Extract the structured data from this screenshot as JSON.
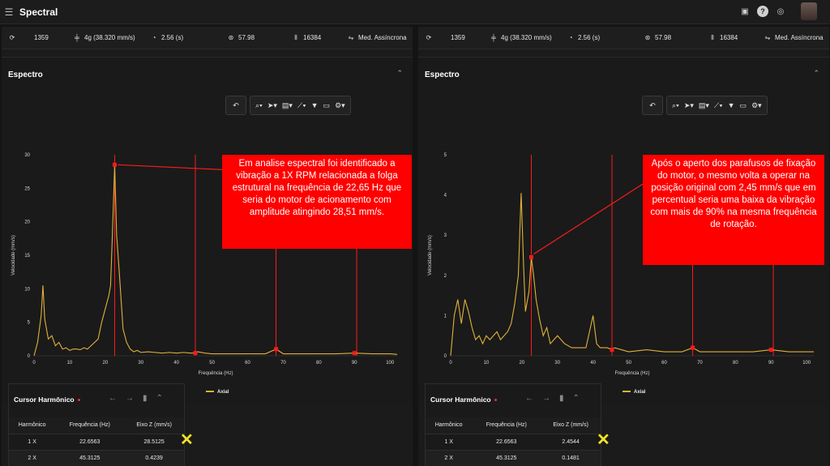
{
  "app": {
    "title": "Spectral"
  },
  "header_icons": [
    "printer-icon",
    "help-icon",
    "globe-icon"
  ],
  "stats": [
    {
      "value": "1359",
      "icon": "sync-icon"
    },
    {
      "value": "4g (38.320 mm/s)",
      "icon": "amplitude-icon"
    },
    {
      "value": "2.56 (s)",
      "icon": "timer-icon"
    },
    {
      "value": "57.98",
      "icon": "frequency-icon"
    },
    {
      "value": "16384",
      "icon": "lines-icon"
    },
    {
      "value": "Med. Assíncrona",
      "icon": "sliders-icon"
    }
  ],
  "spectrum": {
    "title": "Espectro",
    "ylabel": "Velocidade (mm/s)",
    "xlabel": "Frequência (Hz)",
    "legend": "Axial",
    "color_series": "#e0b13b",
    "color_marker": "#ff1a1a"
  },
  "left": {
    "annotation": "Em analise espectral foi identificado a vibração a 1X RPM relacionada a folga estrutural na frequência de 22,65 Hz que seria do motor de acionamento com amplitude atingindo 28,51 mm/s.",
    "harmonic": {
      "title": "Cursor Harmônico",
      "headers": [
        "Harmônico",
        "Frequência (Hz)",
        "Eixo Z (mm/s)"
      ],
      "rows": [
        [
          "1 X",
          "22.6563",
          "28.5125"
        ],
        [
          "2 X",
          "45.3125",
          "0.4239"
        ]
      ]
    }
  },
  "right": {
    "annotation": "Após o aperto dos parafusos de fixação do motor, o mesmo volta a operar na posição original com 2,45 mm/s que em percentual seria uma baixa da vibração com mais de 90% na mesma frequência de rotação.",
    "harmonic": {
      "title": "Cursor Harmônico",
      "headers": [
        "Harmônico",
        "Frequência (Hz)",
        "Eixo Z (mm/s)"
      ],
      "rows": [
        [
          "1 X",
          "22.6563",
          "2.4544"
        ],
        [
          "2 X",
          "45.3125",
          "0.1481"
        ]
      ]
    }
  },
  "chart_data": [
    {
      "type": "line",
      "title": "",
      "xlabel": "Frequência (Hz)",
      "ylabel": "Velocidade (mm/s)",
      "xlim": [
        0,
        102
      ],
      "ylim": [
        0,
        30
      ],
      "xticks": [
        0,
        10,
        20,
        30,
        40,
        50,
        60,
        70,
        80,
        90,
        100
      ],
      "yticks": [
        0,
        5,
        10,
        15,
        20,
        25,
        30
      ],
      "series": [
        {
          "name": "Axial",
          "x": [
            0,
            1,
            2,
            2.5,
            3,
            4,
            5,
            6,
            7,
            8,
            9,
            10,
            11,
            12,
            13,
            14,
            15,
            16,
            17,
            18,
            19,
            20,
            21,
            21.5,
            22,
            22.65,
            23.2,
            24,
            25,
            26,
            27,
            28,
            29,
            30,
            32,
            34,
            36,
            38,
            40,
            42,
            44,
            45.3,
            46,
            48,
            50,
            55,
            60,
            65,
            68,
            70,
            75,
            80,
            85,
            90,
            95,
            100,
            102
          ],
          "y": [
            0,
            2.0,
            6.0,
            10.5,
            5.5,
            2.5,
            3.0,
            1.5,
            2.0,
            1.0,
            1.2,
            0.8,
            1.0,
            1.0,
            0.9,
            1.2,
            1.0,
            1.5,
            2.0,
            2.5,
            5.0,
            7.0,
            9.0,
            10.5,
            18.0,
            28.51,
            18.0,
            12.0,
            4.0,
            2.0,
            1.0,
            0.6,
            0.8,
            0.5,
            0.6,
            0.5,
            0.4,
            0.5,
            0.4,
            0.5,
            0.4,
            0.42,
            0.6,
            0.4,
            0.3,
            0.3,
            0.3,
            0.3,
            1.0,
            0.3,
            0.3,
            0.3,
            0.3,
            0.4,
            0.3,
            0.3,
            0.2
          ]
        }
      ],
      "markers": [
        22.6563,
        45.3125,
        67.97,
        90.63
      ],
      "legend": "bottom"
    },
    {
      "type": "line",
      "title": "",
      "xlabel": "Frequência (Hz)",
      "ylabel": "Velocidade (mm/s)",
      "xlim": [
        0,
        102
      ],
      "ylim": [
        0,
        5
      ],
      "xticks": [
        0,
        10,
        20,
        30,
        40,
        50,
        60,
        70,
        80,
        90,
        100
      ],
      "yticks": [
        0,
        1,
        2,
        3,
        4,
        5
      ],
      "series": [
        {
          "name": "Axial",
          "x": [
            0,
            1,
            2,
            3,
            4,
            5,
            6,
            7,
            8,
            9,
            10,
            11,
            12,
            13,
            14,
            15,
            16,
            17,
            18,
            19,
            19.8,
            20.5,
            21,
            22,
            22.65,
            23.3,
            24,
            25,
            26,
            27,
            28,
            29,
            30,
            32,
            34,
            36,
            38,
            40,
            41,
            42,
            44,
            45.3,
            46,
            48,
            50,
            55,
            60,
            65,
            68,
            70,
            75,
            80,
            85,
            90,
            95,
            100,
            102
          ],
          "y": [
            0,
            1.0,
            1.4,
            0.8,
            1.4,
            1.1,
            0.7,
            0.4,
            0.5,
            0.3,
            0.5,
            0.4,
            0.5,
            0.6,
            0.4,
            0.5,
            0.6,
            0.8,
            1.3,
            2.0,
            4.05,
            2.2,
            1.1,
            1.6,
            2.45,
            2.0,
            1.4,
            0.9,
            0.5,
            0.7,
            0.3,
            0.4,
            0.5,
            0.3,
            0.2,
            0.2,
            0.2,
            1.0,
            0.3,
            0.2,
            0.2,
            0.15,
            0.2,
            0.15,
            0.1,
            0.15,
            0.1,
            0.1,
            0.2,
            0.1,
            0.1,
            0.1,
            0.1,
            0.15,
            0.1,
            0.1,
            0.1
          ]
        }
      ],
      "markers": [
        22.6563,
        45.3125,
        67.97,
        90.63
      ],
      "legend": "bottom"
    }
  ]
}
